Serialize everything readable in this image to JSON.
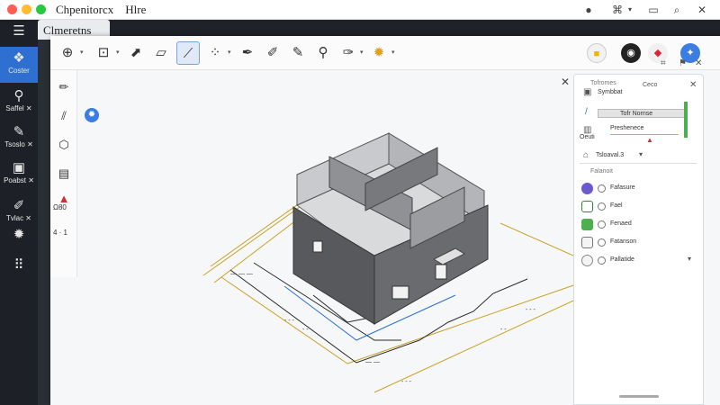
{
  "window": {
    "title": "Chpenitorcx",
    "menu_label": "Hlre"
  },
  "tab": {
    "label": "Clmeretns"
  },
  "leftbar": {
    "items": [
      {
        "icon": "menu-icon",
        "label": ""
      },
      {
        "icon": "layers-icon",
        "label": "Coster"
      },
      {
        "icon": "search-icon",
        "label": "Saffel ✕"
      },
      {
        "icon": "pen-icon",
        "label": "Tsoslo ✕"
      },
      {
        "icon": "window-icon",
        "label": "Poabst ✕"
      },
      {
        "icon": "edit-icon",
        "label": "Tvlac ✕"
      },
      {
        "icon": "gear-icon",
        "label": ""
      },
      {
        "icon": "grid-icon",
        "label": ""
      }
    ]
  },
  "vpalette": {
    "label_dim": "Ω80",
    "label_step": "4 ·  1"
  },
  "panel": {
    "section1_title": "Tofromes",
    "row_symbol": "Symbbat",
    "row_ceco": "Ceco",
    "row_chip1": "Tofr Nornse",
    "row_chip2": "Preshenece",
    "row_oeuti": "Oeuti",
    "row_total": "Tsloaval.3",
    "section2_title": "Falanoit",
    "layers": [
      {
        "label": "Fafasure",
        "color": "#6a5acd"
      },
      {
        "label": "Fael",
        "color": "#2d8a3a"
      },
      {
        "label": "Fenaed",
        "color": "#4caf50"
      },
      {
        "label": "Fatanson",
        "color": "#777777"
      },
      {
        "label": "Pallatide",
        "color": "#888888"
      }
    ]
  },
  "colors": {
    "accent": "#2f6fd1",
    "wall": "#5b5d61",
    "dimension": "#c9a227",
    "blueline": "#2b6fd6"
  }
}
